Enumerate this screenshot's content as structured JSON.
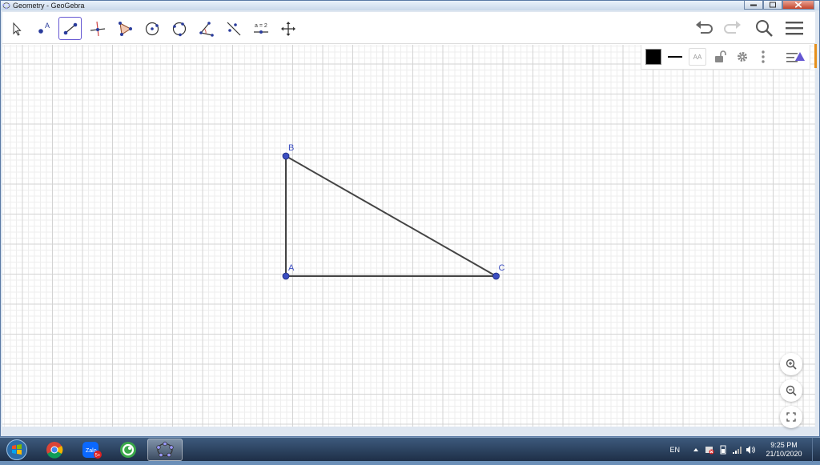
{
  "window": {
    "title": "Geometry - GeoGebra"
  },
  "toolbar": {
    "tools": [
      {
        "name": "move-tool",
        "icon": "arrow-cursor-icon"
      },
      {
        "name": "point-tool",
        "icon": "point-icon",
        "label": "A"
      },
      {
        "name": "segment-tool",
        "icon": "segment-icon",
        "active": true
      },
      {
        "name": "perpendicular-line-tool",
        "icon": "perpendicular-icon"
      },
      {
        "name": "polygon-tool",
        "icon": "polygon-icon"
      },
      {
        "name": "circle-tool",
        "icon": "circle-center-icon"
      },
      {
        "name": "circle-three-points-tool",
        "icon": "circle-three-points-icon"
      },
      {
        "name": "angle-tool",
        "icon": "angle-icon"
      },
      {
        "name": "reflect-tool",
        "icon": "reflect-icon"
      },
      {
        "name": "slider-tool",
        "icon": "slider-icon",
        "label": "a = 2"
      },
      {
        "name": "move-graphics-tool",
        "icon": "move-arrows-icon"
      }
    ],
    "right": [
      "undo-icon",
      "redo-icon",
      "search-icon",
      "menu-icon"
    ]
  },
  "style_bar": {
    "color": "#000000",
    "font_label": "AA"
  },
  "construction": {
    "points": [
      {
        "label": "A",
        "x": 0,
        "y": 0
      },
      {
        "label": "B",
        "x": 0,
        "y": 4
      },
      {
        "label": "C",
        "x": 7,
        "y": 0
      }
    ],
    "segments": [
      [
        "A",
        "B"
      ],
      [
        "B",
        "C"
      ],
      [
        "A",
        "C"
      ]
    ],
    "point_color": "#3c4ec0",
    "segment_color": "#444444"
  },
  "zoom_controls": [
    "zoom-in-icon",
    "zoom-out-icon",
    "fullscreen-icon"
  ],
  "taskbar": {
    "apps": [
      "chrome-icon",
      "zalo-icon",
      "coccoc-icon",
      "geogebra-icon"
    ],
    "zalo_badge": "5+",
    "language": "EN",
    "time": "9:25 PM",
    "date": "21/10/2020"
  }
}
